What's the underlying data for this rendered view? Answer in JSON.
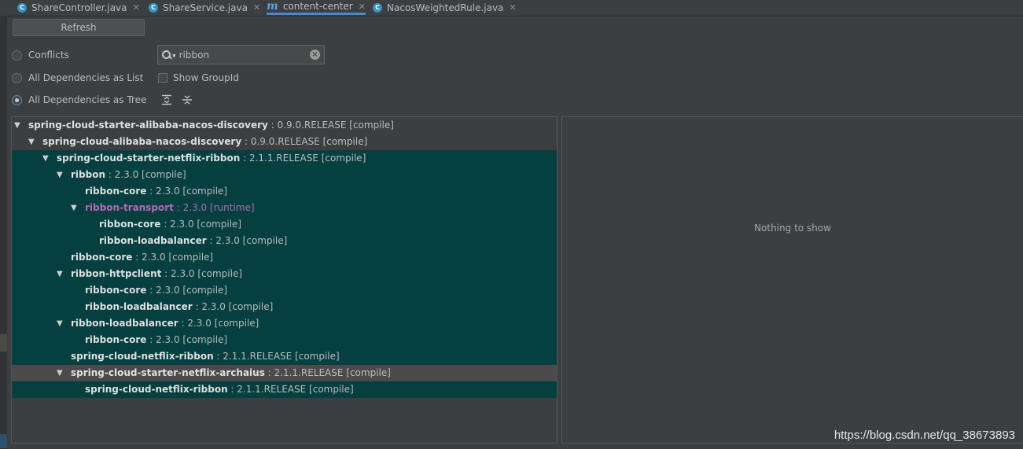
{
  "tabs": [
    {
      "label": "ShareController.java",
      "icon": "class-icon",
      "active": false
    },
    {
      "label": "ShareService.java",
      "icon": "class-icon",
      "active": false
    },
    {
      "label": "content-center",
      "icon": "maven-icon",
      "active": true
    },
    {
      "label": "NacosWeightedRule.java",
      "icon": "class-icon",
      "active": false
    }
  ],
  "toolbar": {
    "refresh_label": "Refresh"
  },
  "options": {
    "conflicts_label": "Conflicts",
    "list_label": "All Dependencies as List",
    "tree_label": "All Dependencies as Tree",
    "show_groupid_label": "Show GroupId",
    "selected_mode": "tree"
  },
  "search": {
    "value": "ribbon",
    "placeholder": ""
  },
  "tree": [
    {
      "name": "spring-cloud-starter-alibaba-nacos-discovery",
      "ver": " : 0.9.0.RELEASE [compile]",
      "expanded": true
    },
    {
      "name": "spring-cloud-alibaba-nacos-discovery",
      "ver": " : 0.9.0.RELEASE [compile]",
      "expanded": true
    },
    {
      "name": "spring-cloud-starter-netflix-ribbon",
      "ver": " : 2.1.1.RELEASE [compile]",
      "expanded": true
    },
    {
      "name": "ribbon",
      "ver": " : 2.3.0 [compile]",
      "expanded": true
    },
    {
      "name": "ribbon-core",
      "ver": " : 2.3.0 [compile]"
    },
    {
      "name": "ribbon-transport",
      "ver": " : 2.3.0 [runtime]",
      "expanded": true
    },
    {
      "name": "ribbon-core",
      "ver": " : 2.3.0 [compile]"
    },
    {
      "name": "ribbon-loadbalancer",
      "ver": " : 2.3.0 [compile]"
    },
    {
      "name": "ribbon-core",
      "ver": " : 2.3.0 [compile]"
    },
    {
      "name": "ribbon-httpclient",
      "ver": " : 2.3.0 [compile]",
      "expanded": true
    },
    {
      "name": "ribbon-core",
      "ver": " : 2.3.0 [compile]"
    },
    {
      "name": "ribbon-loadbalancer",
      "ver": " : 2.3.0 [compile]"
    },
    {
      "name": "ribbon-loadbalancer",
      "ver": " : 2.3.0 [compile]",
      "expanded": true
    },
    {
      "name": "ribbon-core",
      "ver": " : 2.3.0 [compile]"
    },
    {
      "name": "spring-cloud-netflix-ribbon",
      "ver": " : 2.1.1.RELEASE [compile]"
    },
    {
      "name": "spring-cloud-starter-netflix-archaius",
      "ver": " : 2.1.1.RELEASE [compile]",
      "expanded": true
    },
    {
      "name": "spring-cloud-netflix-ribbon",
      "ver": " : 2.1.1.RELEASE [compile]"
    }
  ],
  "details": {
    "empty_text": "Nothing to show"
  },
  "watermark": "https://blog.csdn.net/qq_38673893",
  "colors": {
    "background": "#3c3f41",
    "match_highlight": "#053f40",
    "row_selection": "#4b4b4b",
    "runtime_scope": "#b46bb9",
    "active_tab_underline": "#4a88c7"
  }
}
